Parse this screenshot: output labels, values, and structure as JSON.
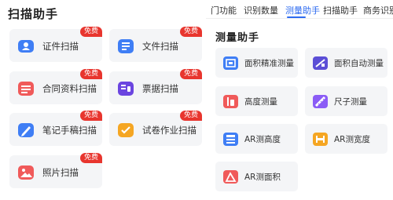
{
  "scan_helper": {
    "title": "扫描助手",
    "items": [
      {
        "label": "证件扫描",
        "badge": "免费"
      },
      {
        "label": "文件扫描",
        "badge": "免费"
      },
      {
        "label": "合同资料扫描",
        "badge": "免费"
      },
      {
        "label": "票据扫描",
        "badge": "免费"
      },
      {
        "label": "笔记手稿扫描",
        "badge": "免费"
      },
      {
        "label": "试卷作业扫描",
        "badge": "免费"
      },
      {
        "label": "照片扫描",
        "badge": "免费"
      }
    ]
  },
  "tabs": [
    {
      "label": "门功能"
    },
    {
      "label": "识别数量"
    },
    {
      "label": "测量助手",
      "active": true
    },
    {
      "label": "扫描助手"
    },
    {
      "label": "商务识别"
    }
  ],
  "measure_helper": {
    "title": "测量助手",
    "items": [
      {
        "label": "面积精准测量"
      },
      {
        "label": "面积自动测量"
      },
      {
        "label": "高度测量"
      },
      {
        "label": "尺子测量"
      },
      {
        "label": "AR测高度"
      },
      {
        "label": "AR测宽度"
      },
      {
        "label": "AR测面积"
      }
    ]
  },
  "colors": {
    "accent": "#2d6bf0",
    "badge": "#e8352e",
    "card_bg": "#f4f5f7"
  },
  "icons": [
    "id-card-icon",
    "document-icon",
    "contract-icon",
    "receipt-icon",
    "pen-note-icon",
    "exam-paper-icon",
    "photo-icon",
    "area-precise-icon",
    "area-auto-icon",
    "height-icon",
    "ruler-icon",
    "ar-height-icon",
    "ar-width-icon",
    "ar-area-icon"
  ]
}
